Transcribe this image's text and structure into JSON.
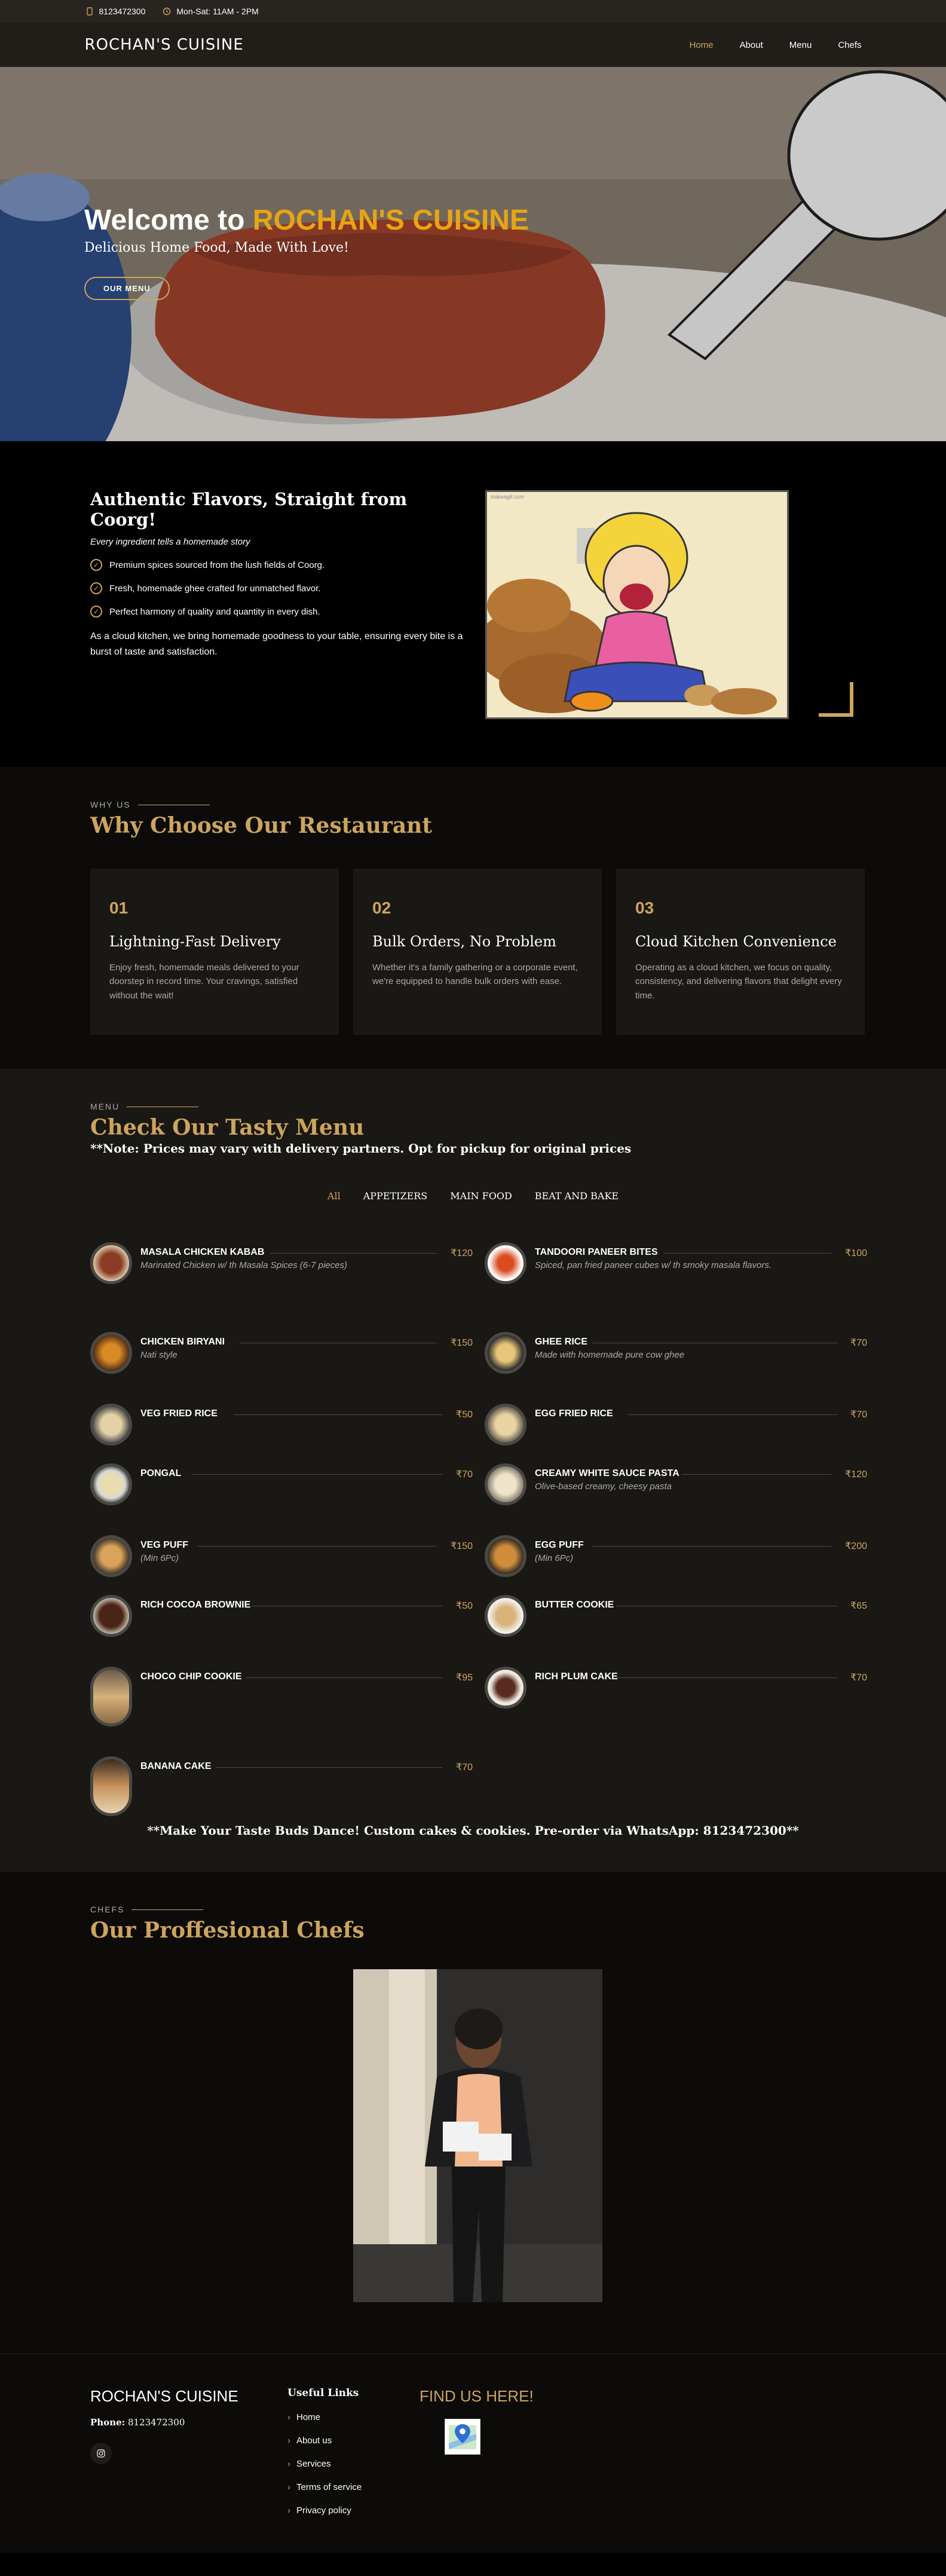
{
  "topbar": {
    "phone": "8123472300",
    "hours": "Mon-Sat: 11AM - 2PM"
  },
  "header": {
    "logo": "ROCHAN'S CUISINE",
    "nav": [
      "Home",
      "About",
      "Menu",
      "Chefs"
    ]
  },
  "hero": {
    "title_prefix": "Welcome to ",
    "title_accent": "ROCHAN'S CUISINE",
    "subtitle": "Delicious Home Food, Made With Love!",
    "button": "OUR MENU"
  },
  "about": {
    "title": "Authentic Flavors, Straight from Coorg!",
    "tagline": "Every ingredient tells a homemade story",
    "bullets": [
      "Premium spices sourced from the lush fields of Coorg.",
      "Fresh, homemade ghee crafted for unmatched flavor.",
      "Perfect harmony of quality and quantity in every dish."
    ],
    "paragraph": "As a cloud kitchen, we bring homemade goodness to your table, ensuring every bite is a burst of taste and satisfaction.",
    "image_caption": "makeagif.com"
  },
  "why": {
    "label": "WHY US",
    "title": "Why Choose Our Restaurant",
    "cards": [
      {
        "num": "01",
        "title": "Lightning-Fast Delivery",
        "desc": "Enjoy fresh, homemade meals delivered to your doorstep in record time. Your cravings, satisfied without the wait!"
      },
      {
        "num": "02",
        "title": "Bulk Orders, No Problem",
        "desc": "Whether it's a family gathering or a corporate event, we're equipped to handle bulk orders with ease."
      },
      {
        "num": "03",
        "title": "Cloud Kitchen Convenience",
        "desc": "Operating as a cloud kitchen, we focus on quality, consistency, and delivering flavors that delight every time."
      }
    ]
  },
  "menu": {
    "label": "MENU",
    "title": "Check Our Tasty Menu",
    "note": "**Note: Prices may vary with delivery partners. Opt for pickup for original prices",
    "filters": [
      "All",
      "APPETIZERS",
      "MAIN FOOD",
      "BEAT AND BAKE"
    ],
    "items": [
      {
        "name": "MASALA CHICKEN KABAB",
        "price": "₹120",
        "desc": "Marinated Chicken w/ th Masala Spices (6-7 pieces)"
      },
      {
        "name": "TANDOORI PANEER BITES",
        "price": "₹100",
        "desc": "Spiced, pan fried paneer cubes w/ th smoky masala flavors."
      },
      {
        "name": "CHICKEN BIRYANI",
        "price": "₹150",
        "desc": "Nati style"
      },
      {
        "name": "GHEE RICE",
        "price": "₹70",
        "desc": "Made with homemade pure cow ghee"
      },
      {
        "name": "VEG FRIED RICE",
        "price": "₹50",
        "desc": ""
      },
      {
        "name": "EGG FRIED RICE",
        "price": "₹70",
        "desc": ""
      },
      {
        "name": "PONGAL",
        "price": "₹70",
        "desc": ""
      },
      {
        "name": "CREAMY WHITE SAUCE PASTA",
        "price": "₹120",
        "desc": "Olive-based creamy, cheesy pasta"
      },
      {
        "name": "VEG PUFF",
        "price": "₹150",
        "desc": "(Min 6Pc)"
      },
      {
        "name": "EGG PUFF",
        "price": "₹200",
        "desc": "(Min 6Pc)"
      },
      {
        "name": "RICH COCOA BROWNIE",
        "price": "₹50",
        "desc": ""
      },
      {
        "name": "BUTTER COOKIE",
        "price": "₹65",
        "desc": ""
      },
      {
        "name": "CHOCO CHIP COOKIE",
        "price": "₹95",
        "desc": ""
      },
      {
        "name": "RICH PLUM CAKE",
        "price": "₹70",
        "desc": ""
      },
      {
        "name": "BANANA CAKE",
        "price": "₹70",
        "desc": ""
      }
    ],
    "footnote": "**Make Your Taste Buds Dance! Custom cakes & cookies. Pre-order via WhatsApp: 8123472300**"
  },
  "chefs": {
    "label": "CHEFS",
    "title": "Our Proffesional Chefs"
  },
  "footer": {
    "brand": "ROCHAN'S CUISINE",
    "phone_label": "Phone:",
    "phone": " 8123472300",
    "links_title": "Useful Links",
    "links": [
      "Home",
      "About us",
      "Services",
      "Terms of service",
      "Privacy policy"
    ],
    "find": "FIND US HERE!"
  },
  "colors": {
    "accent": "#cda45e",
    "hero_accent": "#e8a414",
    "bg": "#0c0b09"
  }
}
